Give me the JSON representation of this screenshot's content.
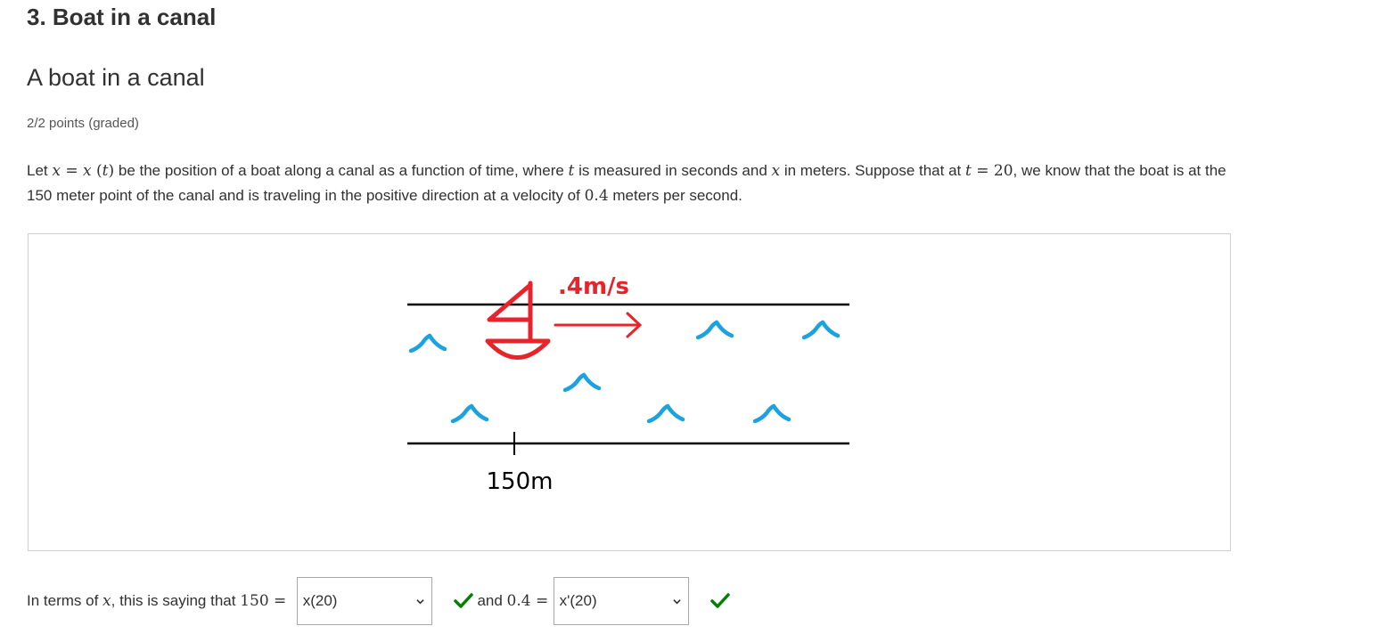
{
  "section": {
    "title": "3. Boat in a canal"
  },
  "problem": {
    "title": "A boat in a canal",
    "points": "2/2 points (graded)",
    "prompt": {
      "p1": "Let ",
      "m1": "x",
      "eq": " = ",
      "m2": "x",
      "paren": " (",
      "m3": "t",
      "paren_close": ")",
      "p2": " be the position of a boat along a canal as a function of time, where ",
      "m4": "t",
      "p3": " is measured in seconds and ",
      "m5": "x",
      "p4": " in meters. Suppose that at ",
      "m6": "t",
      "eq2": " = ",
      "n1": "20",
      "p5": ", we know that the boat is at the 150 meter point of the canal and is traveling in the positive direction at a velocity of ",
      "n2": "0.4",
      "p6": " meters per second."
    }
  },
  "figure": {
    "velocity_label": ".4m/s",
    "position_label": "150m",
    "colors": {
      "boat": "#e8232b",
      "waves": "#1aa3e0",
      "lines": "#000000"
    }
  },
  "answers": {
    "lead": "In terms of ",
    "var": "x",
    "comma": ", this is saying that ",
    "n150": "150",
    "eq": " = ",
    "select1": "x(20)",
    "and": " and ",
    "n04": "0.4",
    "eq2": " = ",
    "select2": "x'(20)",
    "check_color": "#008100"
  }
}
